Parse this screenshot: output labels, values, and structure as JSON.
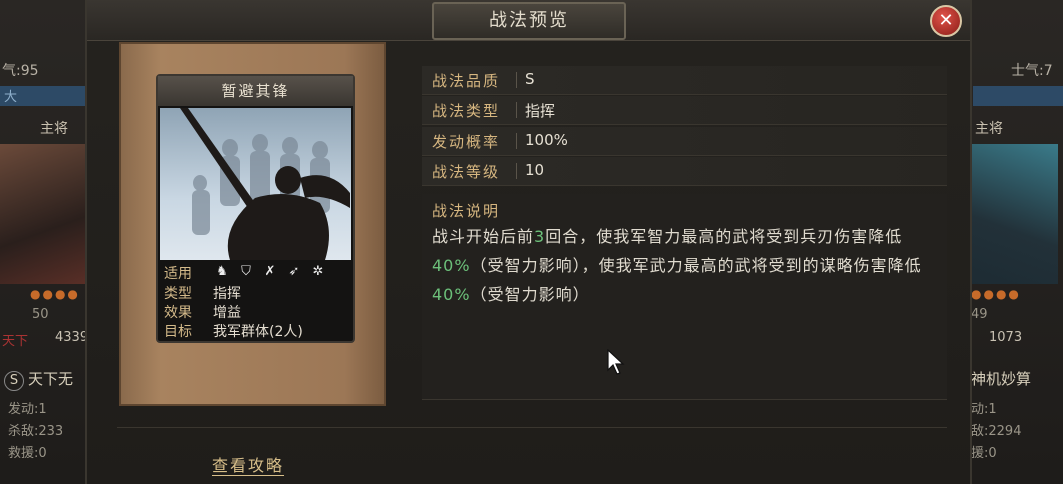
{
  "modal": {
    "title": "战法预览",
    "close_icon": "close-icon"
  },
  "skill_card": {
    "name": "暂避其锋",
    "applicable_label": "适用",
    "applicable_icons": [
      "cavalry-icon",
      "shield-icon",
      "bow-icon",
      "spear-icon",
      "wheel-icon"
    ],
    "type_label": "类型",
    "type_value": "指挥",
    "effect_label": "效果",
    "effect_value": "增益",
    "target_label": "目标",
    "target_value": "我军群体(2人)"
  },
  "info": {
    "rows": [
      {
        "label": "战法品质",
        "value": "S"
      },
      {
        "label": "战法类型",
        "value": "指挥"
      },
      {
        "label": "发动概率",
        "value": "100%"
      },
      {
        "label": "战法等级",
        "value": "10"
      }
    ]
  },
  "description": {
    "label": "战法说明",
    "part1": "战斗开始后前",
    "rounds": "3",
    "part2": "回合，使我军智力最高的武将受到兵刃伤害降低",
    "pct1": "40%",
    "part3": "（受智力影响），使我军武力最高的武将受到的谋略伤害降低",
    "pct2": "40%",
    "part4": "（受智力影响）"
  },
  "footer": {
    "guide_link": "查看攻略"
  },
  "left_panel": {
    "morale": "气:95",
    "bar_text": "大",
    "role": "主将",
    "level": "50",
    "troops": "4339",
    "tag": "天下",
    "skill_badge": "S",
    "skill_name": "天下无",
    "stat1": "发动:1",
    "stat2": "杀敌:233",
    "stat3": "救援:0"
  },
  "right_panel": {
    "morale": "士气:7",
    "role": "主将",
    "level": "49",
    "troops": "1073",
    "skill_name": "神机妙算",
    "stat1": "动:1",
    "stat2": "敌:2294",
    "stat3": "援:0"
  },
  "colors": {
    "label_gold": "#d6b680",
    "highlight_green": "#6cc07a",
    "close_red": "#c9302c"
  }
}
